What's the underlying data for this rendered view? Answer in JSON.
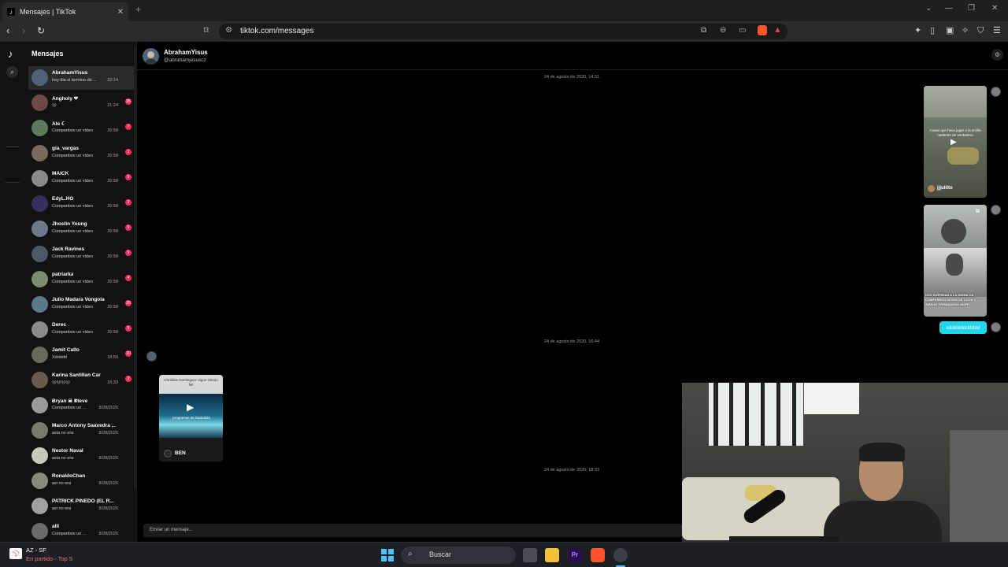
{
  "browser": {
    "tab_title": "Mensajes | TikTok",
    "new_tab": "+",
    "url": "tiktok.com/messages"
  },
  "sidebar": {
    "heading": "Mensajes",
    "conversations": [
      {
        "name": "AbrahamYisus",
        "preview": "hoy dia si termino de ...",
        "time": "22:14",
        "badge": ""
      },
      {
        "name": "Angholy ❤",
        "preview": "☹",
        "time": "21:24",
        "badge": "35"
      },
      {
        "name": "Ale ☾",
        "preview": "Compartiste un video",
        "time": "20:58",
        "badge": "7"
      },
      {
        "name": "gia_vargas",
        "preview": "Compartiste un video",
        "time": "20:58",
        "badge": "1"
      },
      {
        "name": "MAICK",
        "preview": "Compartiste un video",
        "time": "20:58",
        "badge": "6"
      },
      {
        "name": "EdyL.HG",
        "preview": "Compartiste un video",
        "time": "20:58",
        "badge": "2"
      },
      {
        "name": "Jhostin Young",
        "preview": "Compartiste un video",
        "time": "20:58",
        "badge": "6"
      },
      {
        "name": "Jack Ravines",
        "preview": "Compartiste un video",
        "time": "20:58",
        "badge": "6"
      },
      {
        "name": "patriarka",
        "preview": "Compartiste un video",
        "time": "20:58",
        "badge": "4"
      },
      {
        "name": "Julio Madara Vongola",
        "preview": "Compartiste un video",
        "time": "20:58",
        "badge": "20"
      },
      {
        "name": "Derec",
        "preview": "Compartiste un video",
        "time": "20:58",
        "badge": "5"
      },
      {
        "name": "Jamit Callo",
        "preview": "Xddddd",
        "time": "18:59",
        "badge": "10"
      },
      {
        "name": "Karina Santillan Car",
        "preview": "☹☹☹☹",
        "time": "16:33",
        "badge": "2"
      },
      {
        "name": "Ƀryan ☠ ₴teve",
        "preview": "Compartiste un ...",
        "time": "8/28/2026",
        "badge": ""
      },
      {
        "name": "Marco Antony Saavedra ...",
        "preview": "asia no era",
        "time": "8/28/2026",
        "badge": ""
      },
      {
        "name": "Nestor Naval",
        "preview": "asia no era",
        "time": "8/28/2026",
        "badge": ""
      },
      {
        "name": "RonaldoChan",
        "preview": "asi no era",
        "time": "8/28/2026",
        "badge": ""
      },
      {
        "name": "PATRICK PINEDO (EL R...",
        "preview": "asi no era",
        "time": "8/28/2026",
        "badge": ""
      },
      {
        "name": "alli",
        "preview": "Compartiste un ...",
        "time": "8/28/2026",
        "badge": ""
      }
    ]
  },
  "chat": {
    "name": "AbrahamYisus",
    "handle": "@abrahamjesuscz",
    "stamp1": "24 de agosto de 2026, 14:31",
    "stamp2": "24 de agosto de 2026, 16:44",
    "stamp3": "24 de agosto de 2026, 18:33",
    "video1_caption": "Cosas que hace jugar a la arcilla nadando de verdadero",
    "video1_author": "jjjulitto",
    "video2_caption": "DOS DUERMAN A LA MISMA CA COMPAÑERO DESDE DE CUCN Y AMBOS TERMINARON MUER",
    "reply_text": "xddddddddddd",
    "shared_text": "Christian Dominguez sigue siendo fiel",
    "shared_sub": "programas de farándula",
    "shared_user": "BEN",
    "composer_placeholder": "Enviar un mensaje..."
  },
  "taskbar": {
    "weather_title": "AZ - SF",
    "weather_sub": "En partido - Top 5",
    "search_label": "Buscar"
  },
  "colors": {
    "accent": "#fe2c55",
    "reply": "#20d5ec"
  }
}
